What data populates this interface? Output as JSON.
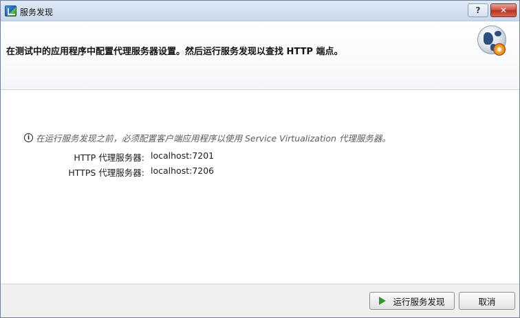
{
  "window": {
    "title": "服务发现",
    "help_label": "?",
    "close_label": "✕"
  },
  "header": {
    "instruction": "在测试中的应用程序中配置代理服务器设置。然后运行服务发现以查找 HTTP 端点。",
    "icon": "globe-gear-icon"
  },
  "body": {
    "info_text": "在运行服务发现之前，必须配置客户端应用程序以使用 Service Virtualization 代理服务器。",
    "info_icon_glyph": "i",
    "proxies": [
      {
        "label": "HTTP 代理服务器:",
        "value": "localhost:7201"
      },
      {
        "label": "HTTPS 代理服务器:",
        "value": "localhost:7206"
      }
    ]
  },
  "footer": {
    "run_label": "运行服务发现",
    "cancel_label": "取消"
  },
  "colors": {
    "title_bar": "#c9d9ec",
    "close_button": "#c9473a",
    "play_icon": "#2e9a2e",
    "footer_bg": "#f0f0f0"
  }
}
